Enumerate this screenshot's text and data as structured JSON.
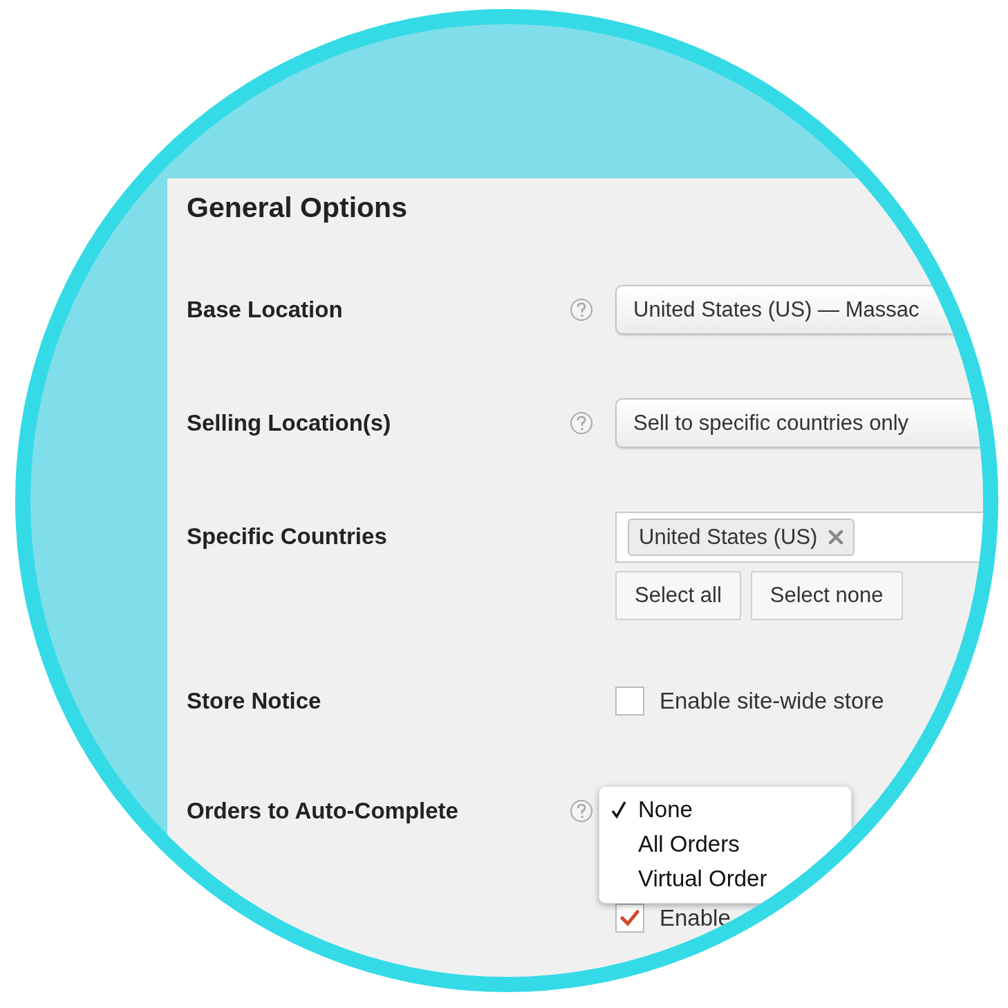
{
  "title": "General Options",
  "rows": [
    {
      "kind": "select",
      "label": "Base Location",
      "help": true,
      "value": "United States (US) — Massac"
    },
    {
      "kind": "select",
      "label": "Selling Location(s)",
      "help": true,
      "value": "Sell to specific countries only"
    },
    {
      "kind": "multiselect",
      "label": "Specific Countries",
      "help": false,
      "tags": [
        "United States (US)"
      ],
      "buttons": [
        "Select all",
        "Select none"
      ]
    },
    {
      "kind": "checkbox",
      "label": "Store Notice",
      "help": false,
      "checked": false,
      "text": "Enable site-wide store"
    },
    {
      "kind": "dropdown",
      "label": "Orders to Auto-Complete",
      "help": true,
      "options": [
        {
          "label": "None",
          "selected": true
        },
        {
          "label": "All Orders",
          "selected": false
        },
        {
          "label": "Virtual Order",
          "selected": false
        }
      ]
    },
    {
      "kind": "checkbox",
      "help": false,
      "checked": true,
      "text": "Enable"
    }
  ]
}
